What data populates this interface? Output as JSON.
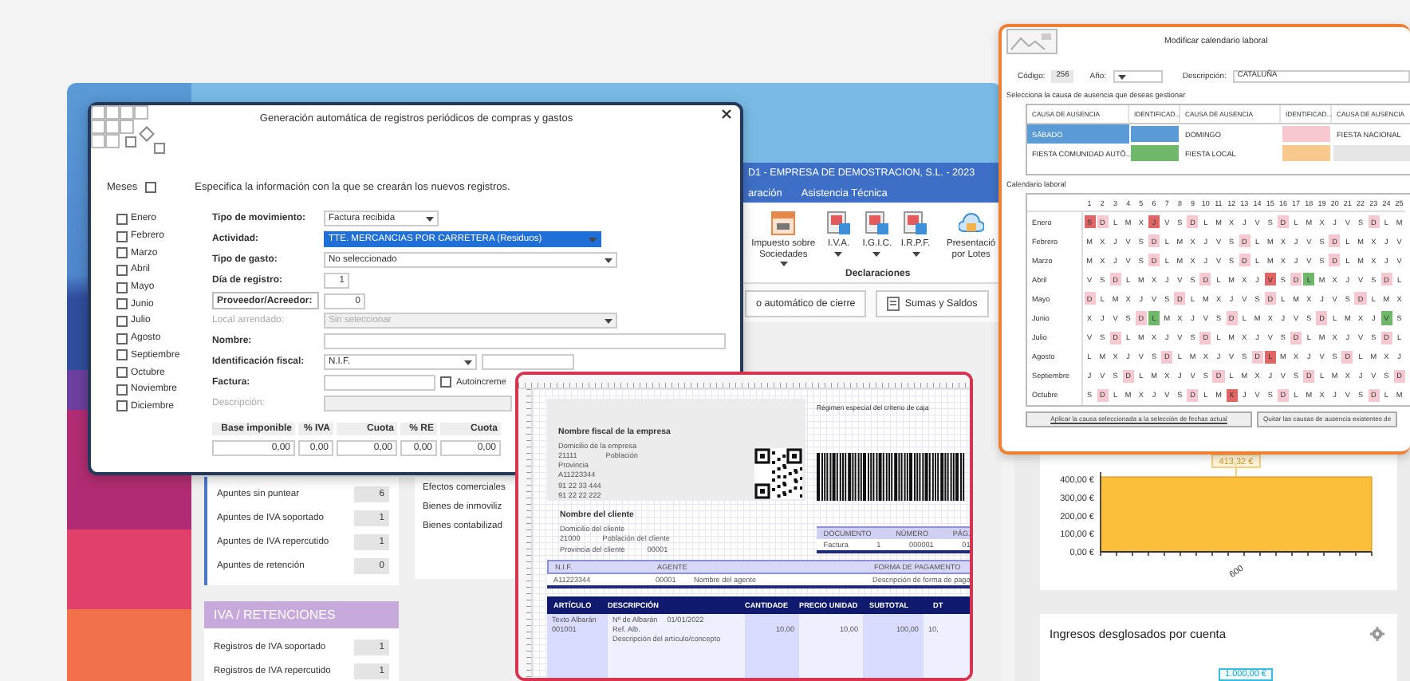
{
  "app": {
    "title": "D1 - EMPRESA DE DEMOSTRACION, S.L. - 2023",
    "menu": [
      "aración",
      "Asistencia Técnica"
    ],
    "ribbon": {
      "items": [
        {
          "label": "Impuesto sobre Sociedades",
          "dropdown": true,
          "kind": "calendar"
        },
        {
          "label": "I.V.A.",
          "dropdown": true,
          "kind": "document"
        },
        {
          "label": "I.G.I.C.",
          "dropdown": true,
          "kind": "document"
        },
        {
          "label": "I.R.P.F.",
          "dropdown": true,
          "kind": "document"
        },
        {
          "label": "Presentació por Lotes",
          "dropdown": false,
          "kind": "cloud"
        }
      ],
      "group": "Declaraciones"
    },
    "actions": [
      "o automático de cierre",
      "Sumas y Saldos"
    ],
    "summary": [
      {
        "label": "Apuntes sin puntear",
        "value": "6"
      },
      {
        "label": "Apuntes de IVA soportado",
        "value": "1"
      },
      {
        "label": "Apuntes de IVA repercutido",
        "value": "1"
      },
      {
        "label": "Apuntes de retención",
        "value": "0"
      }
    ],
    "iva_panel": {
      "title": "IVA / RETENCIONES",
      "rows": [
        {
          "label": "Registros de IVA soportado",
          "value": "1"
        },
        {
          "label": "Registros de IVA repercutido",
          "value": "1"
        }
      ]
    },
    "assets": [
      "Efectos comerciales",
      "Bienes de inmoviliz",
      "Bienes contabilizad"
    ]
  },
  "dashboard": {
    "chart": {
      "chart_data": {
        "type": "bar",
        "categories": [
          "600"
        ],
        "values": [
          413.32
        ],
        "ylim": [
          0,
          440
        ],
        "yticks": [
          {
            "value": 0,
            "label": "0,00 €"
          },
          {
            "value": 100,
            "label": "100,00 €"
          },
          {
            "value": 200,
            "label": "200,00 €"
          },
          {
            "value": 300,
            "label": "300,00 €"
          },
          {
            "value": 400,
            "label": "400,00 €"
          }
        ],
        "value_labels": [
          "413,32 €"
        ]
      }
    },
    "income_card": {
      "title": "Ingresos desglosados por cuenta",
      "value_label": "1.000,00 €"
    }
  },
  "dialog": {
    "title": "Generación automática de registros periódicos de compras y gastos",
    "months_toggle": {
      "label": "Meses",
      "checked": false
    },
    "intro": "Especifica la información con la que se crearán los nuevos registros.",
    "months": [
      {
        "label": "Enero",
        "checked": false
      },
      {
        "label": "Febrero",
        "checked": false
      },
      {
        "label": "Marzo",
        "checked": false
      },
      {
        "label": "Abril",
        "checked": false
      },
      {
        "label": "Mayo",
        "checked": false
      },
      {
        "label": "Junio",
        "checked": false
      },
      {
        "label": "Julio",
        "checked": false
      },
      {
        "label": "Agosto",
        "checked": false
      },
      {
        "label": "Septiembre",
        "checked": false
      },
      {
        "label": "Octubre",
        "checked": false
      },
      {
        "label": "Noviembre",
        "checked": false
      },
      {
        "label": "Diciembre",
        "checked": false
      }
    ],
    "fields": [
      {
        "kind": "short_select",
        "label": "Tipo de movimiento:",
        "value": "Factura recibida",
        "selected": false,
        "disabled": false
      },
      {
        "kind": "select",
        "label": "Actividad:",
        "value": "TTE. MERCANCIAS POR CARRETERA (Residuos)",
        "selected": true,
        "disabled": false
      },
      {
        "kind": "select",
        "label": "Tipo de gasto:",
        "value": "No seleccionado",
        "selected": false,
        "disabled": false
      },
      {
        "kind": "number",
        "label": "Día de registro:",
        "value": "1",
        "selected": false,
        "disabled": false
      },
      {
        "kind": "lookup",
        "label": "Proveedor/Acreedor:",
        "value": "0",
        "selected": false,
        "disabled": false
      },
      {
        "kind": "select",
        "label": "Local arrendado:",
        "value": "Sin seleccionar",
        "selected": false,
        "disabled": true
      },
      {
        "kind": "wide_text",
        "label": "Nombre:",
        "selected": false,
        "disabled": false
      },
      {
        "kind": "nif",
        "label": "Identificación fiscal:",
        "value": "N.I.F.",
        "selected": false,
        "disabled": false
      },
      {
        "kind": "invoice",
        "label": "Factura:",
        "check_label": "Autoincreme",
        "checked": false,
        "selected": false,
        "disabled": false
      },
      {
        "kind": "short_text",
        "label": "Descripción:",
        "selected": false,
        "disabled": true
      }
    ],
    "totals": {
      "columns": [
        "Base imponible",
        "% IVA",
        "Cuota",
        "% RE",
        "Cuota"
      ],
      "values": [
        "0,00",
        "0,00",
        "0,00",
        "0,00",
        "0,00"
      ]
    }
  },
  "invoice": {
    "company": {
      "name": "Nombre fiscal de la empresa",
      "lines": [
        [
          "Domicilio de la empresa"
        ],
        [
          "21111",
          "Población"
        ],
        [
          "Provincia"
        ],
        [
          "A11223344"
        ],
        [
          "91 22 33 444"
        ],
        [
          "91 22 22 222"
        ]
      ]
    },
    "regime": "Régimen especial del criterio de caja",
    "client": {
      "name": "Nombre del cliente",
      "lines": [
        [
          "Domicilio del cliente"
        ],
        [
          "21000",
          "Población del cliente"
        ],
        [
          "Provincia del cliente",
          "00001"
        ]
      ]
    },
    "document": {
      "columns": [
        "DOCUMENTO",
        "NÚMERO",
        "PÁG."
      ],
      "row": [
        "Factura",
        "1",
        "000001",
        "01"
      ]
    },
    "agent": {
      "columns": [
        "N.I.F.",
        "AGENTE",
        "FORMA DE PAGAMENTO"
      ],
      "row": [
        "A11223344",
        "00001",
        "Nombre del agente",
        "Descripción de forma de pago"
      ]
    },
    "items": {
      "columns": [
        "ARTÍCULO",
        "DESCRIPCIÓN",
        "CANTIDADE",
        "PRECIO UNIDAD",
        "SUBTOTAL",
        "DT"
      ],
      "row": {
        "article": [
          "Texto Albarán",
          "001001"
        ],
        "description": [
          "Nº de Albarán",
          "01/01/2022",
          "Ref. Alb.",
          "Descripción del artículo/concepto"
        ],
        "quantity": "10,00",
        "price": "10,00",
        "subtotal": "100,00",
        "discount": "10,"
      }
    }
  },
  "calendar": {
    "title": "Modificar calendario laboral",
    "code_label": "Código:",
    "code": "256",
    "year_label": "Año:",
    "description_label": "Descripción:",
    "description": "CATALUÑA",
    "causes_caption": "Selecciona la causa de ausencia que deseas gestionar",
    "causes": {
      "columns": [
        "CAUSA DE AUSENCIA",
        "IDENTIFICAD...",
        "CAUSA DE AUSENCIA",
        "IDENTIFICAD...",
        "CAUSA DE AUSENCIA"
      ],
      "items": [
        {
          "name": "SÁBADO",
          "color": "#5b9bd5",
          "selected": true
        },
        {
          "name": "DOMINGO",
          "color": "#f6c9d0",
          "selected": false
        },
        {
          "name": "FIESTA NACIONAL",
          "selected": false
        },
        {
          "name": "FIESTA COMUNIDAD AUTÓ...",
          "color": "#6fb86a",
          "selected": false
        },
        {
          "name": "FIESTA LOCAL",
          "color": "#f7c98c",
          "selected": false
        }
      ]
    },
    "grid_caption": "Calendario laboral",
    "day_numbers": [
      "1",
      "2",
      "3",
      "4",
      "5",
      "6",
      "7",
      "8",
      "9",
      "10",
      "11",
      "12",
      "13",
      "14",
      "15",
      "16",
      "17",
      "18",
      "19",
      "20",
      "21",
      "22",
      "23",
      "24",
      "25"
    ],
    "months": [
      {
        "name": "Enero",
        "days": [
          {
            "d": "S",
            "color": "#e06666"
          },
          {
            "d": "D",
            "color": "#f6c9d0"
          },
          {
            "d": "L"
          },
          {
            "d": "M"
          },
          {
            "d": "X"
          },
          {
            "d": "J",
            "color": "#e06666"
          },
          {
            "d": "V"
          },
          {
            "d": "S"
          },
          {
            "d": "D",
            "color": "#f6c9d0"
          },
          {
            "d": "L"
          },
          {
            "d": "M"
          },
          {
            "d": "X"
          },
          {
            "d": "J"
          },
          {
            "d": "V"
          },
          {
            "d": "S"
          },
          {
            "d": "D",
            "color": "#f6c9d0"
          },
          {
            "d": "L"
          },
          {
            "d": "M"
          },
          {
            "d": "X"
          },
          {
            "d": "J"
          },
          {
            "d": "V"
          },
          {
            "d": "S"
          },
          {
            "d": "D",
            "color": "#f6c9d0"
          },
          {
            "d": "L"
          },
          {
            "d": "M"
          }
        ]
      },
      {
        "name": "Febrero",
        "days": [
          {
            "d": "M"
          },
          {
            "d": "X"
          },
          {
            "d": "J"
          },
          {
            "d": "V"
          },
          {
            "d": "S"
          },
          {
            "d": "D",
            "color": "#f6c9d0"
          },
          {
            "d": "L"
          },
          {
            "d": "M"
          },
          {
            "d": "X"
          },
          {
            "d": "J"
          },
          {
            "d": "V"
          },
          {
            "d": "S"
          },
          {
            "d": "D",
            "color": "#f6c9d0"
          },
          {
            "d": "L"
          },
          {
            "d": "M"
          },
          {
            "d": "X"
          },
          {
            "d": "J"
          },
          {
            "d": "V"
          },
          {
            "d": "S"
          },
          {
            "d": "D",
            "color": "#f6c9d0"
          },
          {
            "d": "L"
          },
          {
            "d": "M"
          },
          {
            "d": "X"
          },
          {
            "d": "J"
          },
          {
            "d": "V"
          }
        ]
      },
      {
        "name": "Marzo",
        "days": [
          {
            "d": "M"
          },
          {
            "d": "X"
          },
          {
            "d": "J"
          },
          {
            "d": "V"
          },
          {
            "d": "S"
          },
          {
            "d": "D",
            "color": "#f6c9d0"
          },
          {
            "d": "L"
          },
          {
            "d": "M"
          },
          {
            "d": "X"
          },
          {
            "d": "J"
          },
          {
            "d": "V"
          },
          {
            "d": "S"
          },
          {
            "d": "D",
            "color": "#f6c9d0"
          },
          {
            "d": "L"
          },
          {
            "d": "M"
          },
          {
            "d": "X"
          },
          {
            "d": "J"
          },
          {
            "d": "V"
          },
          {
            "d": "S"
          },
          {
            "d": "D",
            "color": "#f6c9d0"
          },
          {
            "d": "L"
          },
          {
            "d": "M"
          },
          {
            "d": "X"
          },
          {
            "d": "J"
          },
          {
            "d": "V"
          }
        ]
      },
      {
        "name": "Abril",
        "days": [
          {
            "d": "V"
          },
          {
            "d": "S"
          },
          {
            "d": "D",
            "color": "#f6c9d0"
          },
          {
            "d": "L"
          },
          {
            "d": "M"
          },
          {
            "d": "X"
          },
          {
            "d": "J"
          },
          {
            "d": "V"
          },
          {
            "d": "S"
          },
          {
            "d": "D",
            "color": "#f6c9d0"
          },
          {
            "d": "L"
          },
          {
            "d": "M"
          },
          {
            "d": "X"
          },
          {
            "d": "J"
          },
          {
            "d": "V",
            "color": "#e06666"
          },
          {
            "d": "S"
          },
          {
            "d": "D",
            "color": "#f6c9d0"
          },
          {
            "d": "L",
            "color": "#6fb86a"
          },
          {
            "d": "M"
          },
          {
            "d": "X"
          },
          {
            "d": "J"
          },
          {
            "d": "V"
          },
          {
            "d": "S"
          },
          {
            "d": "D",
            "color": "#f6c9d0"
          },
          {
            "d": "L"
          }
        ]
      },
      {
        "name": "Mayo",
        "days": [
          {
            "d": "D",
            "color": "#f6c9d0"
          },
          {
            "d": "L"
          },
          {
            "d": "M"
          },
          {
            "d": "X"
          },
          {
            "d": "J"
          },
          {
            "d": "V"
          },
          {
            "d": "S"
          },
          {
            "d": "D",
            "color": "#f6c9d0"
          },
          {
            "d": "L"
          },
          {
            "d": "M"
          },
          {
            "d": "X"
          },
          {
            "d": "J"
          },
          {
            "d": "V"
          },
          {
            "d": "S"
          },
          {
            "d": "D",
            "color": "#f6c9d0"
          },
          {
            "d": "L"
          },
          {
            "d": "M"
          },
          {
            "d": "X"
          },
          {
            "d": "J"
          },
          {
            "d": "V"
          },
          {
            "d": "S"
          },
          {
            "d": "D",
            "color": "#f6c9d0"
          },
          {
            "d": "L"
          },
          {
            "d": "M"
          },
          {
            "d": "X"
          }
        ]
      },
      {
        "name": "Junio",
        "days": [
          {
            "d": "X"
          },
          {
            "d": "J"
          },
          {
            "d": "V"
          },
          {
            "d": "S"
          },
          {
            "d": "D",
            "color": "#f6c9d0"
          },
          {
            "d": "L",
            "color": "#6fb86a"
          },
          {
            "d": "M"
          },
          {
            "d": "X"
          },
          {
            "d": "J"
          },
          {
            "d": "V"
          },
          {
            "d": "S"
          },
          {
            "d": "D",
            "color": "#f6c9d0"
          },
          {
            "d": "L"
          },
          {
            "d": "M"
          },
          {
            "d": "X"
          },
          {
            "d": "J"
          },
          {
            "d": "V"
          },
          {
            "d": "S"
          },
          {
            "d": "D",
            "color": "#f6c9d0"
          },
          {
            "d": "L"
          },
          {
            "d": "M"
          },
          {
            "d": "X"
          },
          {
            "d": "J"
          },
          {
            "d": "V",
            "color": "#6fb86a"
          },
          {
            "d": "S"
          }
        ]
      },
      {
        "name": "Julio",
        "days": [
          {
            "d": "V"
          },
          {
            "d": "S"
          },
          {
            "d": "D",
            "color": "#f6c9d0"
          },
          {
            "d": "L"
          },
          {
            "d": "M"
          },
          {
            "d": "X"
          },
          {
            "d": "J"
          },
          {
            "d": "V"
          },
          {
            "d": "S"
          },
          {
            "d": "D",
            "color": "#f6c9d0"
          },
          {
            "d": "L"
          },
          {
            "d": "M"
          },
          {
            "d": "X"
          },
          {
            "d": "J"
          },
          {
            "d": "V"
          },
          {
            "d": "S"
          },
          {
            "d": "D",
            "color": "#f6c9d0"
          },
          {
            "d": "L"
          },
          {
            "d": "M"
          },
          {
            "d": "X"
          },
          {
            "d": "J"
          },
          {
            "d": "V"
          },
          {
            "d": "S"
          },
          {
            "d": "D",
            "color": "#f6c9d0"
          },
          {
            "d": "L"
          }
        ]
      },
      {
        "name": "Agosto",
        "days": [
          {
            "d": "L"
          },
          {
            "d": "M"
          },
          {
            "d": "X"
          },
          {
            "d": "J"
          },
          {
            "d": "V"
          },
          {
            "d": "S"
          },
          {
            "d": "D",
            "color": "#f6c9d0"
          },
          {
            "d": "L"
          },
          {
            "d": "M"
          },
          {
            "d": "X"
          },
          {
            "d": "J"
          },
          {
            "d": "V"
          },
          {
            "d": "S"
          },
          {
            "d": "D",
            "color": "#f6c9d0"
          },
          {
            "d": "L",
            "color": "#e06666"
          },
          {
            "d": "M"
          },
          {
            "d": "X"
          },
          {
            "d": "J"
          },
          {
            "d": "V"
          },
          {
            "d": "S"
          },
          {
            "d": "D",
            "color": "#f6c9d0"
          },
          {
            "d": "L"
          },
          {
            "d": "M"
          },
          {
            "d": "X"
          },
          {
            "d": "J"
          }
        ]
      },
      {
        "name": "Septiembre",
        "days": [
          {
            "d": "J"
          },
          {
            "d": "V"
          },
          {
            "d": "S"
          },
          {
            "d": "D",
            "color": "#f6c9d0"
          },
          {
            "d": "L"
          },
          {
            "d": "M"
          },
          {
            "d": "X"
          },
          {
            "d": "J"
          },
          {
            "d": "V"
          },
          {
            "d": "S"
          },
          {
            "d": "D",
            "color": "#f6c9d0"
          },
          {
            "d": "L"
          },
          {
            "d": "M"
          },
          {
            "d": "X"
          },
          {
            "d": "J"
          },
          {
            "d": "V"
          },
          {
            "d": "S"
          },
          {
            "d": "D",
            "color": "#f6c9d0"
          },
          {
            "d": "L"
          },
          {
            "d": "M"
          },
          {
            "d": "X"
          },
          {
            "d": "J"
          },
          {
            "d": "V"
          },
          {
            "d": "S"
          },
          {
            "d": "D",
            "color": "#f6c9d0"
          }
        ]
      },
      {
        "name": "Octubre",
        "days": [
          {
            "d": "S"
          },
          {
            "d": "D",
            "color": "#f6c9d0"
          },
          {
            "d": "L"
          },
          {
            "d": "M"
          },
          {
            "d": "X"
          },
          {
            "d": "J"
          },
          {
            "d": "V"
          },
          {
            "d": "S"
          },
          {
            "d": "D",
            "color": "#f6c9d0"
          },
          {
            "d": "L"
          },
          {
            "d": "M"
          },
          {
            "d": "X",
            "color": "#e06666"
          },
          {
            "d": "J"
          },
          {
            "d": "V"
          },
          {
            "d": "S"
          },
          {
            "d": "D",
            "color": "#f6c9d0"
          },
          {
            "d": "L"
          },
          {
            "d": "M"
          },
          {
            "d": "X"
          },
          {
            "d": "J"
          },
          {
            "d": "V"
          },
          {
            "d": "S"
          },
          {
            "d": "D",
            "color": "#f6c9d0"
          },
          {
            "d": "L"
          },
          {
            "d": "M"
          }
        ]
      }
    ],
    "buttons": [
      "Aplicar la causa seleccionada a la selección de fechas actual",
      "Quitar las causas de ausencia existentes de"
    ]
  }
}
